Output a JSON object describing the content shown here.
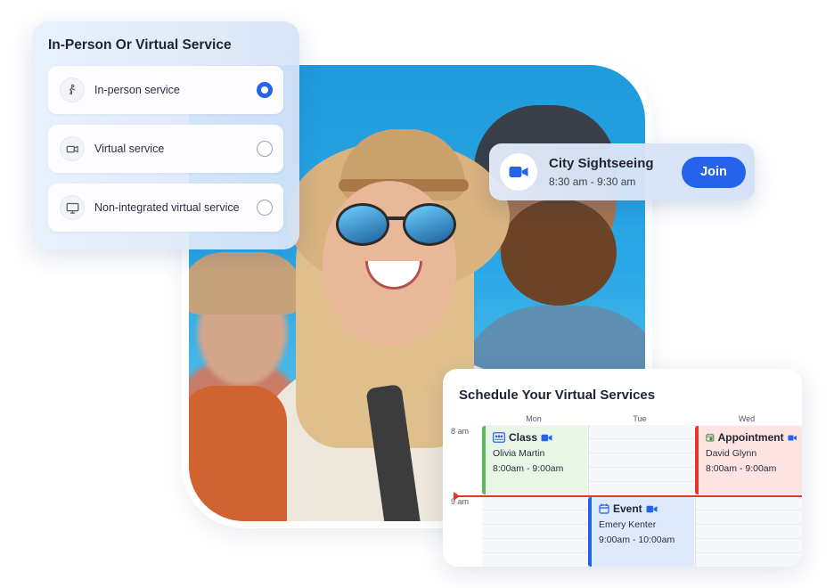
{
  "service_panel": {
    "title": "In-Person Or Virtual Service",
    "options": [
      {
        "label": "In-person service",
        "icon": "walking-person-icon",
        "selected": true
      },
      {
        "label": "Virtual service",
        "icon": "video-camera-icon",
        "selected": false
      },
      {
        "label": "Non-integrated virtual service",
        "icon": "monitor-icon",
        "selected": false
      }
    ]
  },
  "meeting": {
    "title": "City Sightseeing",
    "time": "8:30 am - 9:30 am",
    "join_label": "Join",
    "icon": "video-camera-icon"
  },
  "schedule": {
    "title": "Schedule Your Virtual Services",
    "days": [
      "Mon",
      "Tue",
      "Wed"
    ],
    "hours": [
      "8 am",
      "9 am"
    ],
    "events": [
      {
        "type": "Class",
        "name": "Olivia Martin",
        "time": "8:00am - 9:00am",
        "day": "Mon",
        "color": "#5cb85c"
      },
      {
        "type": "Appointment",
        "name": "David Glynn",
        "time": "8:00am - 9:00am",
        "day": "Wed",
        "color": "#e5362c"
      },
      {
        "type": "Event",
        "name": "Emery Kenter",
        "time": "9:00am - 10:00am",
        "day": "Tue",
        "color": "#2563eb"
      }
    ]
  },
  "colors": {
    "accent": "#2563eb",
    "now_line": "#e5362c"
  }
}
